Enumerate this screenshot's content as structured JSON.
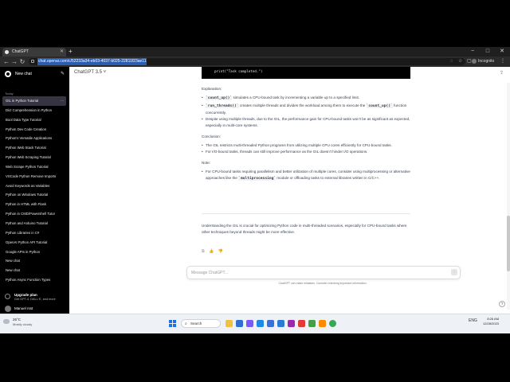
{
  "browser": {
    "tab_title": "ChatGPT",
    "new_tab": "+",
    "url": "chat.openai.com/c/52233a34-eb03-4037-b025-22811f23ae11",
    "incognito_label": "Incognito",
    "window_controls": [
      "−",
      "□",
      "✕"
    ]
  },
  "sidebar": {
    "new_chat": "New chat",
    "section_label": "Today",
    "history": [
      "GIL in Python Tutorial",
      "Dict Comprehension in Python",
      "Bool Data Type Tutorial",
      "Python Dev Code Creation",
      "Python's Versatile Applications",
      "Python Web Stack Tutorial",
      "Python Web Scraping Tutorial",
      "Web Scrape Python Tutorial",
      "VSCode Python Remove Imports",
      "Avoid Keywords as Variables",
      "Python on Windows Tutorial",
      "Python in HTML with Flask",
      "Python in CMD/Powershell Tutor",
      "Python and Arduino Tutorial",
      "Python Libraries in C#",
      "OpenAI Python API Tutorial",
      "Google APIs in Python",
      "New chat",
      "New chat",
      "Python Async Function Types"
    ],
    "active_dots": "⋯",
    "upgrade_title": "Upgrade plan",
    "upgrade_subtitle": "Get GPT-4, DALL·E, and more",
    "user_name": "Manuel rsst"
  },
  "main": {
    "model": "ChatGPT 3.5 ˅",
    "code_line": "print(\"Task completed.\")",
    "explanation_heading": "Explanation:",
    "expl1_code": "`count_up()`",
    "expl1_text": " simulates a CPU-bound task by incrementing a variable up to a specified limit.",
    "expl2_code": "`run_threads()`",
    "expl2_text_a": " creates multiple threads and divides the workload among them to execute the ",
    "expl2_code_b": "`count_up()`",
    "expl2_text_b": " function concurrently.",
    "expl3": "Despite using multiple threads, due to the GIL, the performance gain for CPU-bound tasks won't be as significant as expected, especially in multi-core systems.",
    "conclusion_heading": "Conclusion:",
    "concl1": "The GIL restricts multi-threaded Python programs from utilizing multiple CPU cores efficiently for CPU-bound tasks.",
    "concl2": "For I/O-bound tasks, threads can still improve performance as the GIL doesn't hinder I/O operations.",
    "note_heading": "Note:",
    "note_text_a": "For CPU-bound tasks requiring parallelism and better utilization of multiple cores, consider using multiprocessing or alternative approaches like the ",
    "note_code": "`multiprocessing`",
    "note_text_b": " module or offloading tasks to external libraries written in C/C++.",
    "summary": "Understanding the GIL is crucial for optimizing Python code in multi-threaded scenarios, especially for CPU-bound tasks where other techniques beyond threads might be more effective.",
    "message_actions": "⧉ 👍 👎",
    "input_placeholder": "Message ChatGPT...",
    "send_icon": "↑",
    "disclaimer": "ChatGPT can make mistakes. Consider checking important information.",
    "help": "?"
  },
  "taskbar": {
    "temp": "26°C",
    "weather": "Mostly cloudy",
    "search_label": "Search",
    "lang": "ENG",
    "time": "8:26 AM",
    "date": "12/28/2023"
  },
  "colors": {
    "sidebar_bg": "#000000",
    "accent": "#1a73e8",
    "url_highlight": "#2a5db0"
  }
}
